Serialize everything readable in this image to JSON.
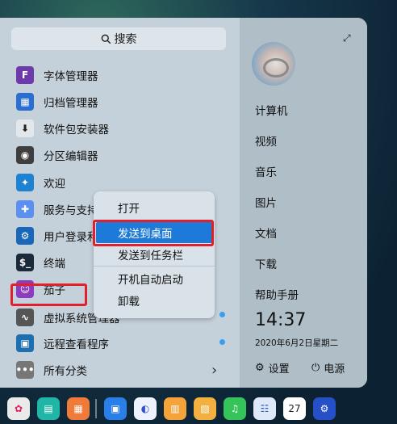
{
  "search": {
    "label": "搜索"
  },
  "apps": [
    {
      "label": "字体管理器",
      "icon": "font-manager-icon",
      "color": "#6d3aa9",
      "glyph": "F"
    },
    {
      "label": "归档管理器",
      "icon": "archive-manager-icon",
      "color": "#2b6ed0",
      "glyph": "▦"
    },
    {
      "label": "软件包安装器",
      "icon": "package-installer-icon",
      "color": "#e3e7ea",
      "glyph": "⬇"
    },
    {
      "label": "分区编辑器",
      "icon": "partition-editor-icon",
      "color": "#3e3e3e",
      "glyph": "◉"
    },
    {
      "label": "欢迎",
      "icon": "welcome-icon",
      "color": "#1f82d0",
      "glyph": "✦"
    },
    {
      "label": "服务与支持",
      "icon": "support-icon",
      "color": "#5b8ff0",
      "glyph": "✚"
    },
    {
      "label": "用户登录和",
      "icon": "user-login-icon",
      "color": "#1a66b8",
      "glyph": "⚙"
    },
    {
      "label": "终端",
      "icon": "terminal-icon",
      "color": "#1b2a3a",
      "glyph": "$_"
    },
    {
      "label": "茄子",
      "icon": "cheese-icon",
      "color": "#8e3cbf",
      "glyph": "☺"
    },
    {
      "label": "虚拟系统管理器",
      "icon": "virt-manager-icon",
      "color": "#555",
      "glyph": "∿"
    },
    {
      "label": "远程查看程序",
      "icon": "remote-viewer-icon",
      "color": "#1e6fb0",
      "glyph": "▣"
    },
    {
      "label": "所有分类",
      "icon": "all-categories-icon",
      "color": "#777",
      "glyph": "•••"
    }
  ],
  "context_menu": {
    "items": [
      "打开",
      "发送到桌面",
      "发送到任务栏",
      "开机自动启动",
      "卸载"
    ],
    "selected_index": 1
  },
  "right_panel": {
    "links": [
      "计算机",
      "视频",
      "音乐",
      "图片",
      "文档",
      "下载",
      "帮助手册"
    ],
    "time": "14:37",
    "date": "2020年6月2日星期二",
    "settings_label": "设置",
    "power_label": "电源"
  },
  "colors": {
    "selection": "#1e7ad8",
    "annotation_red": "#e0202a",
    "new_dot": "#3a9df0"
  }
}
